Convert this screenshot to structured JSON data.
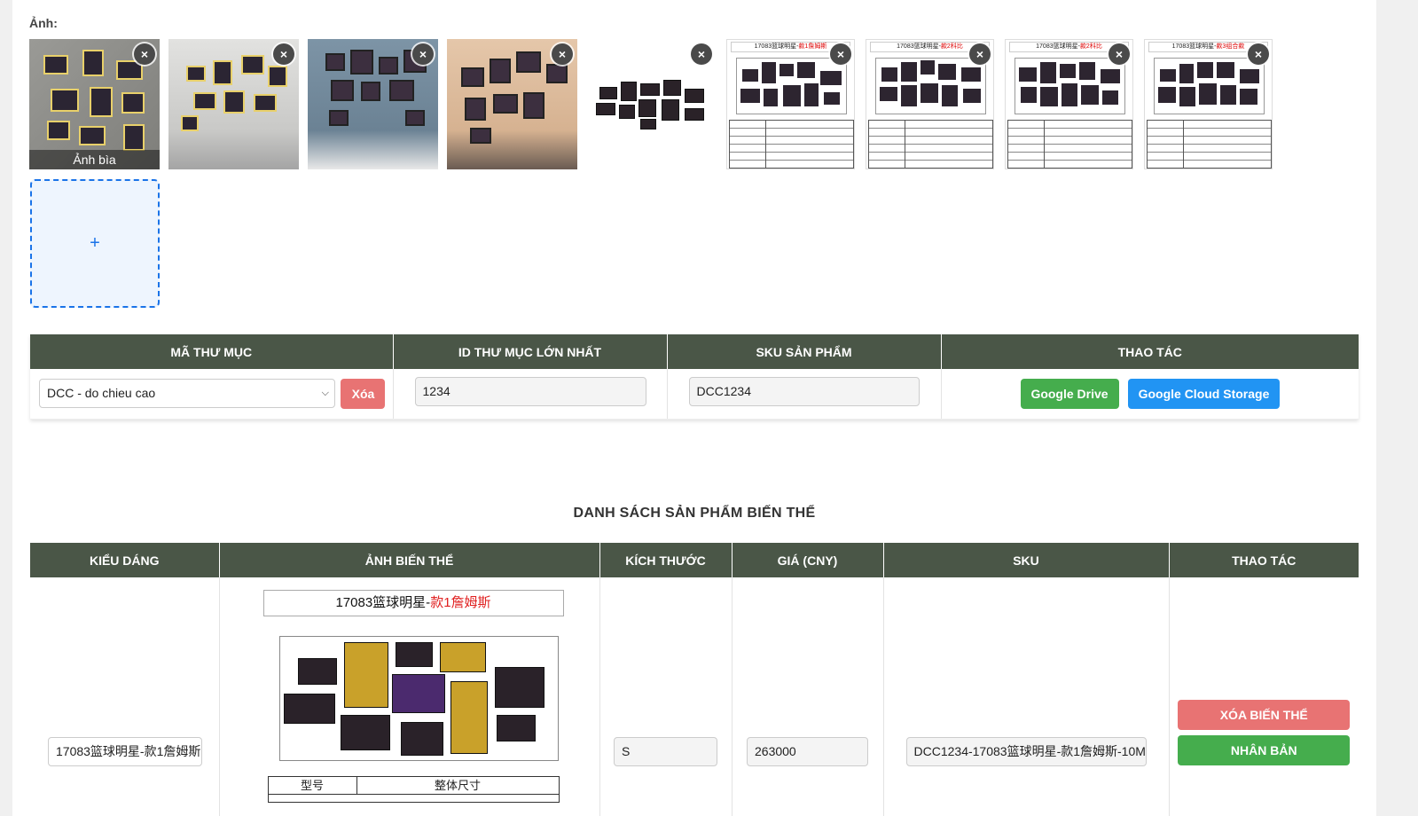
{
  "images": {
    "label": "Ảnh:",
    "cover_caption": "Ảnh bìa",
    "close_symbol": "×",
    "add_symbol": "+",
    "spec_titles": [
      {
        "prefix": "17083篮球明星-",
        "highlight": "款1詹姆斯"
      },
      {
        "prefix": "17083篮球明星-",
        "highlight": "款2科比"
      },
      {
        "prefix": "17083篮球明星-",
        "highlight": "款2科比"
      },
      {
        "prefix": "17083篮球明星-",
        "highlight": "款3组合款"
      }
    ]
  },
  "folder_table": {
    "headers": [
      "MÃ THƯ MỤC",
      "ID THƯ MỤC LỚN NHẤT",
      "SKU SẢN PHẨM",
      "THAO TÁC"
    ],
    "folder_select_value": "DCC - do chieu cao",
    "delete_label": "Xóa",
    "max_id_value": "1234",
    "sku_value": "DCC1234",
    "google_drive_label": "Google Drive",
    "gcs_label": "Google Cloud Storage"
  },
  "variant_list": {
    "title": "DANH SÁCH SẢN PHẨM BIẾN THỂ",
    "headers": [
      "KIỂU DÁNG",
      "ẢNH BIẾN THỂ",
      "KÍCH THƯỚC",
      "GIÁ (CNY)",
      "SKU",
      "THAO TÁC"
    ],
    "rows": [
      {
        "style_value": "17083篮球明星-款1詹姆斯",
        "image_title_prefix": "17083篮球明星-",
        "image_title_highlight": "款1詹姆斯",
        "grid_col1": "型号",
        "grid_col2": "整体尺寸",
        "size_value": "S",
        "price_value": "263000",
        "sku_value": "DCC1234-17083篮球明星-款1詹姆斯-10M",
        "delete_label": "XÓA BIẾN THỂ",
        "duplicate_label": "NHÂN BẢN"
      }
    ]
  }
}
